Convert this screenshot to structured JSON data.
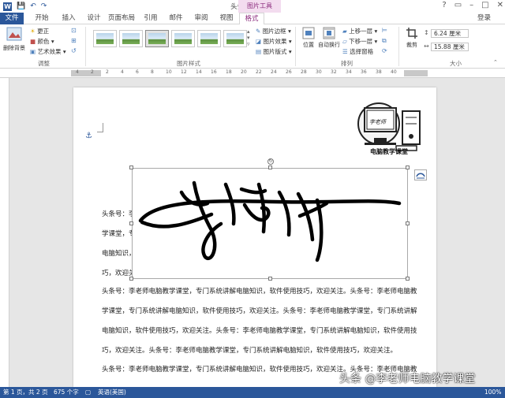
{
  "window": {
    "title": "头条号 - Word",
    "context_group": "图片工具",
    "login": "登录"
  },
  "qat": {
    "save": "💾",
    "undo": "↶",
    "redo": "↷"
  },
  "tabs": [
    "文件",
    "开始",
    "插入",
    "设计",
    "页面布局",
    "引用",
    "邮件",
    "审阅",
    "视图",
    "格式"
  ],
  "ribbon": {
    "adjust": {
      "label": "调整",
      "remove_bg": "删除背景",
      "corrections": "更正",
      "color": "颜色",
      "artistic": "艺术效果"
    },
    "styles": {
      "label": "图片样式",
      "border": "图片边框",
      "effects": "图片效果",
      "layout": "图片版式"
    },
    "arrange": {
      "label": "排列",
      "position": "位置",
      "wrap": "自动换行",
      "forward": "上移一层",
      "backward": "下移一层",
      "selection": "选择窗格"
    },
    "size": {
      "label": "大小",
      "crop": "裁剪",
      "height": "6.24 厘米",
      "width": "15.88 厘米"
    }
  },
  "ruler_numbers": [
    "4",
    "2",
    "2",
    "4",
    "6",
    "8",
    "10",
    "12",
    "14",
    "16",
    "18",
    "20",
    "22",
    "24",
    "26",
    "28",
    "30",
    "32",
    "34",
    "36",
    "38",
    "40"
  ],
  "document": {
    "logo_caption": "电脑教学课堂",
    "logo_screen_text": "李老师",
    "paragraphs": [
      "头条号：李",
      "学课堂，专",
      "电脑知识，",
      "巧，欢迎关",
      "头条号：李老师电脑教学课堂，专门系统讲解电脑知识，软件使用技巧，欢迎关注。头条号：李老师电脑教",
      "学课堂，专门系统讲解电脑知识，软件使用技巧，欢迎关注。头条号：李老师电脑教学课堂，专门系统讲解",
      "电脑知识，软件使用技巧，欢迎关注。头条号：李老师电脑教学课堂，专门系统讲解电脑知识，软件使用技",
      "巧，欢迎关注。头条号：李老师电脑教学课堂，专门系统讲解电脑知识，软件使用技巧，欢迎关注。",
      "头条号：李老师电脑教学课堂，专门系统讲解电脑知识，软件使用技巧，欢迎关注。头条号：李老师电脑教"
    ]
  },
  "status": {
    "page": "第 1 页，共 2 页",
    "words": "675 个字",
    "language": "英语(美国)",
    "zoom": "100%"
  },
  "watermark": "头条 @李老师电脑教学课堂",
  "colors": {
    "accent": "#2b579a",
    "context": "#8b2b7d"
  }
}
